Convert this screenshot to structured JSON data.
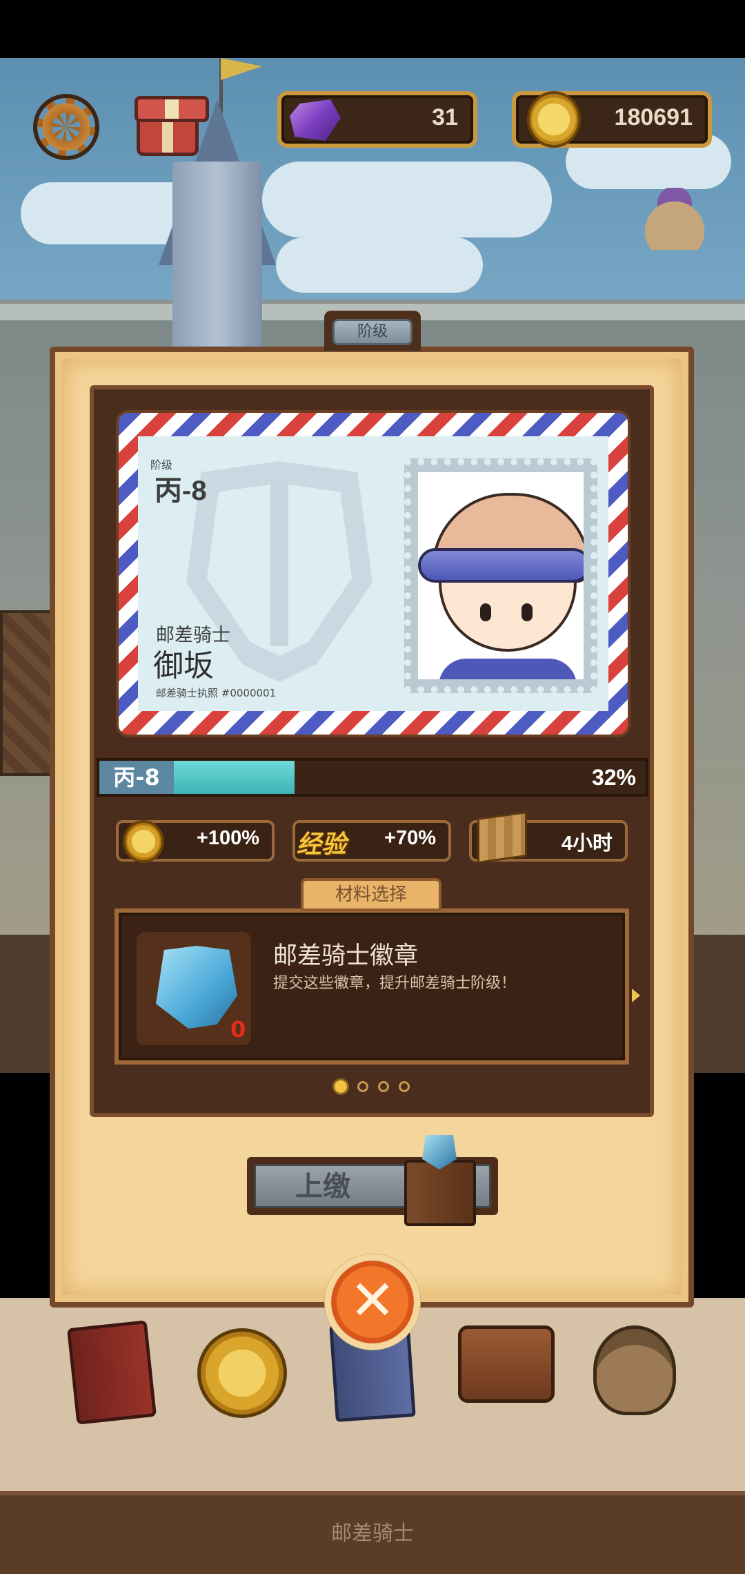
{
  "hud": {
    "gems": "31",
    "coins": "180691",
    "settings_icon": "gear-icon",
    "gift_icon": "gift-icon"
  },
  "panel": {
    "tab_label": "阶级",
    "license": {
      "rank_caption": "阶级",
      "rank": "丙-8",
      "job_title": "邮差骑士",
      "character_name": "御坂",
      "license_number": "邮差骑士执照 #0000001"
    },
    "progress": {
      "label": "丙-8",
      "percent_text": "32%",
      "fraction": 0.32
    },
    "bonuses": [
      {
        "icon": "coin-icon",
        "value": "+100%"
      },
      {
        "icon": "exp-label",
        "label": "经验",
        "value": "+70%"
      },
      {
        "icon": "crate-icon",
        "value": "4小时"
      }
    ],
    "materials": {
      "tab_label": "材料选择",
      "item_name": "邮差骑士徽章",
      "item_desc": "提交这些徽章，提升邮差骑士阶级！",
      "count": "0",
      "page_count": 4,
      "current_page": 1
    },
    "submit_label": "上缴"
  },
  "bottom": {
    "title": "邮差骑士"
  },
  "colors": {
    "progress_fill": "#3fb3b5",
    "panel_bg": "#f4d59c",
    "close_button": "#f2772a",
    "count_red": "#e52b1d"
  }
}
